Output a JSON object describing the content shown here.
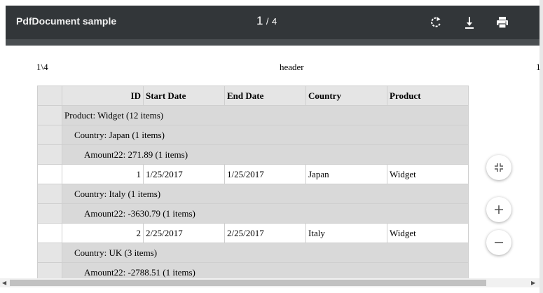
{
  "toolbar": {
    "title": "PdfDocument sample",
    "current_page": "1",
    "page_separator": "/",
    "total_pages": "4",
    "icons": [
      "rotate-icon",
      "download-icon",
      "print-icon"
    ]
  },
  "page": {
    "page_counter": "1\\4",
    "header": "header",
    "edge_text": "1"
  },
  "grid": {
    "columns": [
      "ID",
      "Start Date",
      "End Date",
      "Country",
      "Product"
    ],
    "rows": [
      {
        "type": "group",
        "level": 0,
        "text": "Product: Widget (12 items)"
      },
      {
        "type": "group",
        "level": 1,
        "text": "Country: Japan (1 items)"
      },
      {
        "type": "group",
        "level": 2,
        "text": "Amount22: 271.89 (1 items)"
      },
      {
        "type": "data",
        "cells": [
          "1",
          "1/25/2017",
          "1/25/2017",
          "Japan",
          "Widget"
        ]
      },
      {
        "type": "group",
        "level": 1,
        "text": "Country: Italy (1 items)"
      },
      {
        "type": "group",
        "level": 2,
        "text": "Amount22: -3630.79 (1 items)"
      },
      {
        "type": "data",
        "cells": [
          "2",
          "2/25/2017",
          "2/25/2017",
          "Italy",
          "Widget"
        ]
      },
      {
        "type": "group",
        "level": 1,
        "text": "Country: UK (3 items)"
      },
      {
        "type": "group",
        "level": 2,
        "text": "Amount22: -2788.51 (1 items)"
      }
    ]
  },
  "zoom": {
    "buttons": [
      "fit-page-icon",
      "zoom-in-icon",
      "zoom-out-icon"
    ]
  },
  "scrollbar": {
    "left_arrow": "◀",
    "right_arrow": "▶"
  }
}
